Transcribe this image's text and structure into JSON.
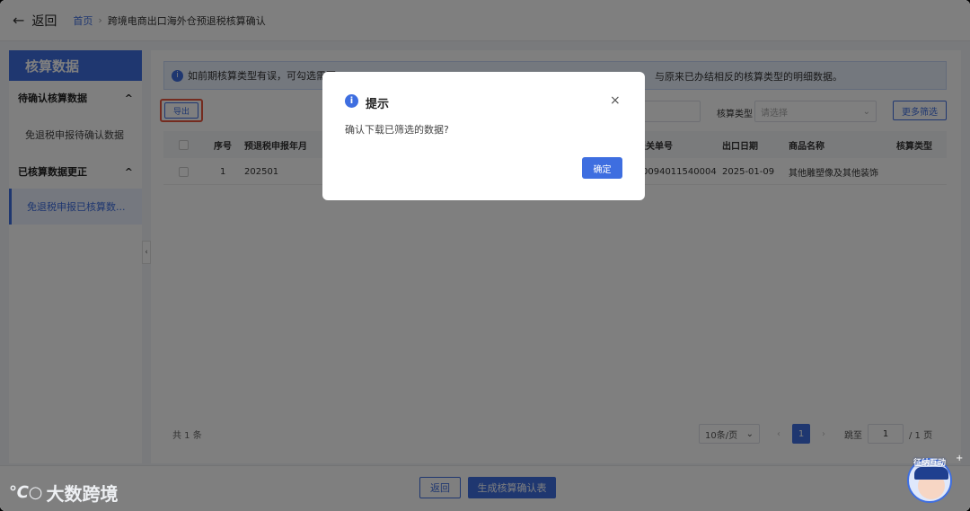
{
  "header": {
    "back_arrow": "←",
    "back_label": "返回",
    "breadcrumb_home": "首页",
    "breadcrumb_sep": "›",
    "breadcrumb_current": "跨境电商出口海外仓预退税核算确认"
  },
  "sidebar": {
    "title": "核算数据",
    "groups": [
      {
        "label": "待确认核算数据",
        "chevron": "^",
        "items": [
          "免退税申报待确认数据"
        ]
      },
      {
        "label": "已核算数据更正",
        "chevron": "^",
        "items": [
          "免退税申报已核算数..."
        ]
      }
    ],
    "collapse_glyph": "‹"
  },
  "notice": {
    "icon": "i",
    "text_left": "如前期核算类型有误，可勾选需要",
    "text_right": "与原来已办结相反的核算类型的明细数据。"
  },
  "toolbar": {
    "export_label": "导出",
    "filter_label": "核算类型",
    "filter_placeholder": "请选择",
    "filter_chevron": "⌄",
    "more_filter_label": "更多筛选"
  },
  "table": {
    "columns": [
      "",
      "序号",
      "预退税申报年月",
      "报关单号",
      "出口日期",
      "商品名称",
      "核算类型"
    ],
    "rows": [
      {
        "index": "1",
        "period": "202501",
        "customs_no": "0094011540004",
        "export_date": "2025-01-09",
        "product": "其他雕塑像及其他装饰",
        "type": ""
      }
    ]
  },
  "pagination": {
    "total": "共 1 条",
    "page_size": "10条/页",
    "page_size_chevron": "⌄",
    "prev": "‹",
    "current": "1",
    "next": "›",
    "jump_label": "跳至",
    "jump_value": "1",
    "total_pages": "/ 1 页"
  },
  "footer": {
    "back_label": "返回",
    "generate_label": "生成核算确认表"
  },
  "dialog": {
    "icon": "i",
    "title": "提示",
    "close": "×",
    "message": "确认下载已筛选的数据?",
    "ok_label": "确定"
  },
  "watermark": {
    "logo": "℃○",
    "text": "大数跨境"
  },
  "mascot": {
    "label": "征纳互动",
    "plus": "+"
  },
  "colors": {
    "primary": "#3e6ee0",
    "highlight_border": "#e9573f"
  }
}
